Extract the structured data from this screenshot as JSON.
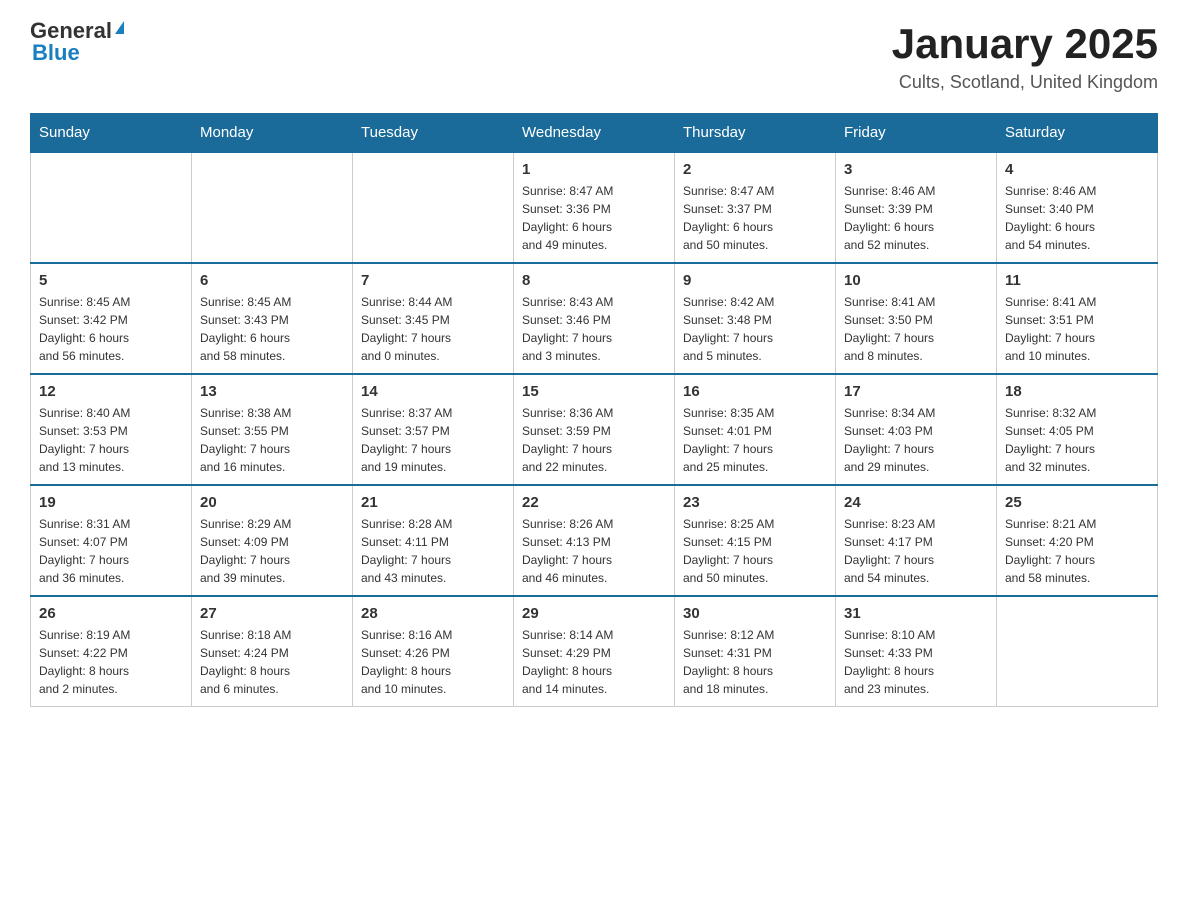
{
  "logo": {
    "general": "General",
    "blue": "Blue"
  },
  "header": {
    "month": "January 2025",
    "location": "Cults, Scotland, United Kingdom"
  },
  "weekdays": [
    "Sunday",
    "Monday",
    "Tuesday",
    "Wednesday",
    "Thursday",
    "Friday",
    "Saturday"
  ],
  "weeks": [
    [
      {
        "day": "",
        "info": ""
      },
      {
        "day": "",
        "info": ""
      },
      {
        "day": "",
        "info": ""
      },
      {
        "day": "1",
        "info": "Sunrise: 8:47 AM\nSunset: 3:36 PM\nDaylight: 6 hours\nand 49 minutes."
      },
      {
        "day": "2",
        "info": "Sunrise: 8:47 AM\nSunset: 3:37 PM\nDaylight: 6 hours\nand 50 minutes."
      },
      {
        "day": "3",
        "info": "Sunrise: 8:46 AM\nSunset: 3:39 PM\nDaylight: 6 hours\nand 52 minutes."
      },
      {
        "day": "4",
        "info": "Sunrise: 8:46 AM\nSunset: 3:40 PM\nDaylight: 6 hours\nand 54 minutes."
      }
    ],
    [
      {
        "day": "5",
        "info": "Sunrise: 8:45 AM\nSunset: 3:42 PM\nDaylight: 6 hours\nand 56 minutes."
      },
      {
        "day": "6",
        "info": "Sunrise: 8:45 AM\nSunset: 3:43 PM\nDaylight: 6 hours\nand 58 minutes."
      },
      {
        "day": "7",
        "info": "Sunrise: 8:44 AM\nSunset: 3:45 PM\nDaylight: 7 hours\nand 0 minutes."
      },
      {
        "day": "8",
        "info": "Sunrise: 8:43 AM\nSunset: 3:46 PM\nDaylight: 7 hours\nand 3 minutes."
      },
      {
        "day": "9",
        "info": "Sunrise: 8:42 AM\nSunset: 3:48 PM\nDaylight: 7 hours\nand 5 minutes."
      },
      {
        "day": "10",
        "info": "Sunrise: 8:41 AM\nSunset: 3:50 PM\nDaylight: 7 hours\nand 8 minutes."
      },
      {
        "day": "11",
        "info": "Sunrise: 8:41 AM\nSunset: 3:51 PM\nDaylight: 7 hours\nand 10 minutes."
      }
    ],
    [
      {
        "day": "12",
        "info": "Sunrise: 8:40 AM\nSunset: 3:53 PM\nDaylight: 7 hours\nand 13 minutes."
      },
      {
        "day": "13",
        "info": "Sunrise: 8:38 AM\nSunset: 3:55 PM\nDaylight: 7 hours\nand 16 minutes."
      },
      {
        "day": "14",
        "info": "Sunrise: 8:37 AM\nSunset: 3:57 PM\nDaylight: 7 hours\nand 19 minutes."
      },
      {
        "day": "15",
        "info": "Sunrise: 8:36 AM\nSunset: 3:59 PM\nDaylight: 7 hours\nand 22 minutes."
      },
      {
        "day": "16",
        "info": "Sunrise: 8:35 AM\nSunset: 4:01 PM\nDaylight: 7 hours\nand 25 minutes."
      },
      {
        "day": "17",
        "info": "Sunrise: 8:34 AM\nSunset: 4:03 PM\nDaylight: 7 hours\nand 29 minutes."
      },
      {
        "day": "18",
        "info": "Sunrise: 8:32 AM\nSunset: 4:05 PM\nDaylight: 7 hours\nand 32 minutes."
      }
    ],
    [
      {
        "day": "19",
        "info": "Sunrise: 8:31 AM\nSunset: 4:07 PM\nDaylight: 7 hours\nand 36 minutes."
      },
      {
        "day": "20",
        "info": "Sunrise: 8:29 AM\nSunset: 4:09 PM\nDaylight: 7 hours\nand 39 minutes."
      },
      {
        "day": "21",
        "info": "Sunrise: 8:28 AM\nSunset: 4:11 PM\nDaylight: 7 hours\nand 43 minutes."
      },
      {
        "day": "22",
        "info": "Sunrise: 8:26 AM\nSunset: 4:13 PM\nDaylight: 7 hours\nand 46 minutes."
      },
      {
        "day": "23",
        "info": "Sunrise: 8:25 AM\nSunset: 4:15 PM\nDaylight: 7 hours\nand 50 minutes."
      },
      {
        "day": "24",
        "info": "Sunrise: 8:23 AM\nSunset: 4:17 PM\nDaylight: 7 hours\nand 54 minutes."
      },
      {
        "day": "25",
        "info": "Sunrise: 8:21 AM\nSunset: 4:20 PM\nDaylight: 7 hours\nand 58 minutes."
      }
    ],
    [
      {
        "day": "26",
        "info": "Sunrise: 8:19 AM\nSunset: 4:22 PM\nDaylight: 8 hours\nand 2 minutes."
      },
      {
        "day": "27",
        "info": "Sunrise: 8:18 AM\nSunset: 4:24 PM\nDaylight: 8 hours\nand 6 minutes."
      },
      {
        "day": "28",
        "info": "Sunrise: 8:16 AM\nSunset: 4:26 PM\nDaylight: 8 hours\nand 10 minutes."
      },
      {
        "day": "29",
        "info": "Sunrise: 8:14 AM\nSunset: 4:29 PM\nDaylight: 8 hours\nand 14 minutes."
      },
      {
        "day": "30",
        "info": "Sunrise: 8:12 AM\nSunset: 4:31 PM\nDaylight: 8 hours\nand 18 minutes."
      },
      {
        "day": "31",
        "info": "Sunrise: 8:10 AM\nSunset: 4:33 PM\nDaylight: 8 hours\nand 23 minutes."
      },
      {
        "day": "",
        "info": ""
      }
    ]
  ]
}
